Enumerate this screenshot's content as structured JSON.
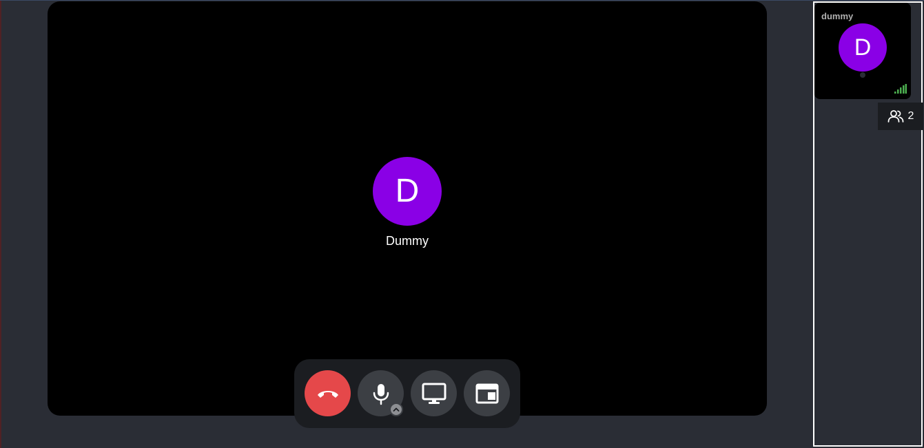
{
  "main": {
    "avatar_initial": "D",
    "participant_name": "Dummy"
  },
  "toolbar": {
    "hangup_icon": "phone-hangup-icon",
    "mic_icon": "microphone-icon",
    "mic_options_icon": "chevron-up-icon",
    "screen_icon": "monitor-icon",
    "layout_icon": "layout-icon"
  },
  "side": {
    "tile": {
      "name": "dummy",
      "avatar_initial": "D",
      "signal_icon": "signal-bars-icon"
    },
    "participants_count": "2",
    "participants_icon": "people-icon"
  },
  "colors": {
    "avatar": "#8a00e6",
    "hangup": "#e5484a",
    "signal": "#4caf50",
    "background": "#2a2d35"
  }
}
